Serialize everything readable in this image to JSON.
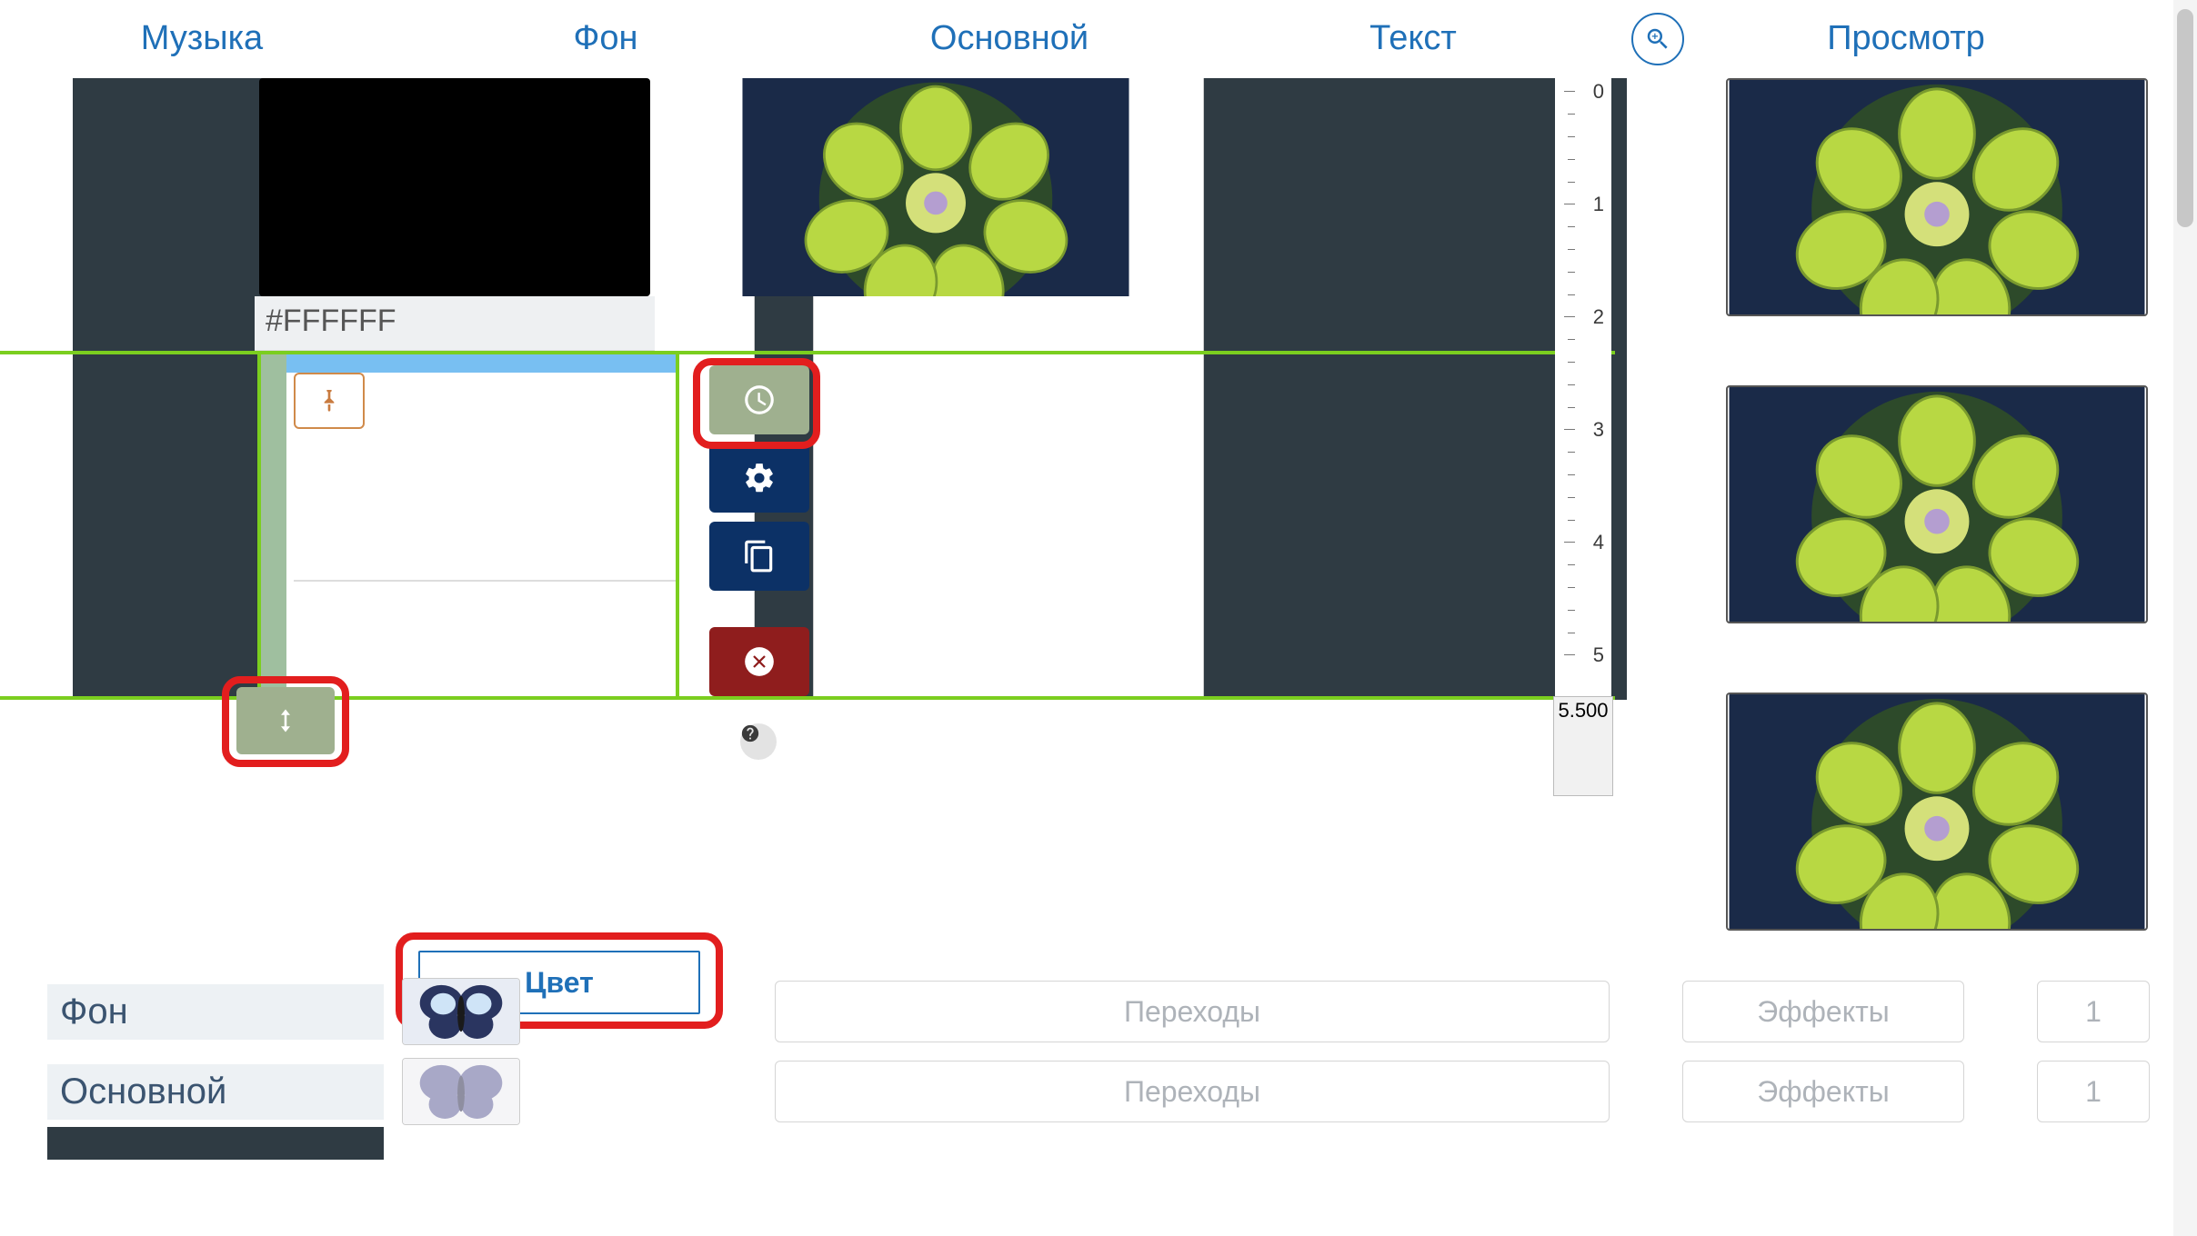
{
  "tabs": {
    "music": "Музыка",
    "background": "Фон",
    "main": "Основной",
    "text": "Текст",
    "preview": "Просмотр"
  },
  "fon": {
    "hex": "#FFFFFF"
  },
  "ruler": {
    "ticks": [
      "0",
      "1",
      "2",
      "3",
      "4",
      "5"
    ],
    "end": "5.500"
  },
  "buttons": {
    "color": "Цвет",
    "transitions": "Переходы",
    "effects": "Эффекты"
  },
  "layers": [
    {
      "name": "Фон",
      "count": "1"
    },
    {
      "name": "Основной",
      "count": "1"
    }
  ],
  "icons": {
    "zoom": "zoom-in-icon",
    "pin": "pin-icon",
    "clock": "clock-icon",
    "gear": "gear-icon",
    "copy": "copy-icon",
    "delete": "delete-icon",
    "help": "help-icon",
    "drag": "drag-vertical-icon"
  },
  "colors": {
    "accent": "#1f70b8",
    "olive": "#9fb08f",
    "navy": "#0c3166",
    "danger": "#8f1d1d",
    "callout": "#e21e1e",
    "selection": "#7bce1f"
  }
}
